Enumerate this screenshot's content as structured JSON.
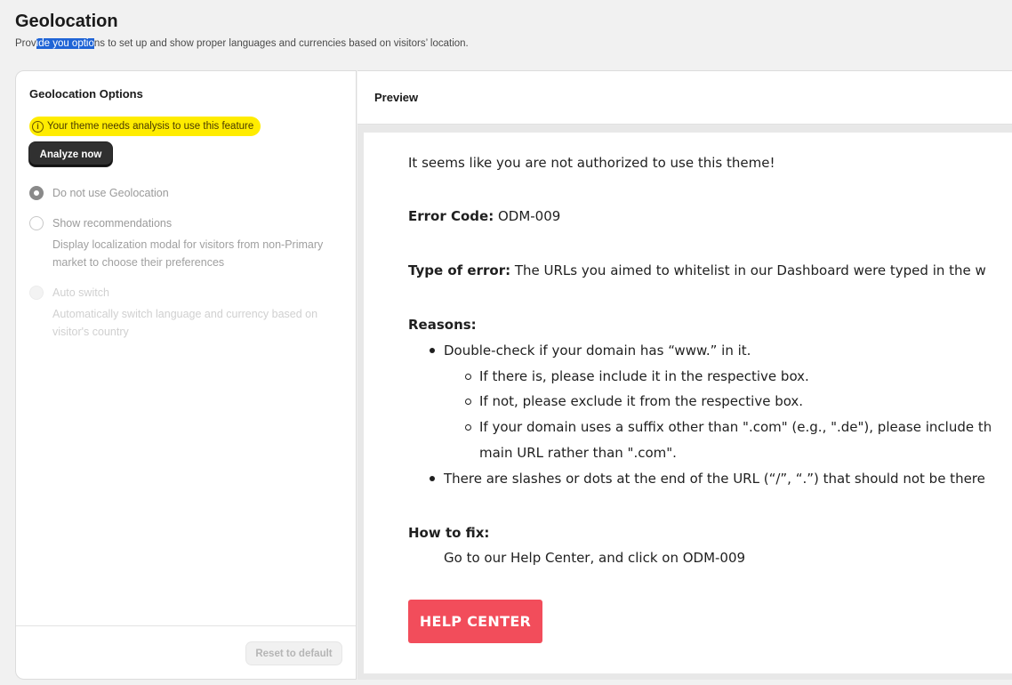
{
  "header": {
    "title": "Geolocation",
    "subtitle_pre": "Prov",
    "subtitle_selected": "ide you optio",
    "subtitle_post": "ns to set up and show proper languages and currencies based on visitors’ location."
  },
  "options": {
    "title": "Geolocation Options",
    "warning": "Your theme needs analysis to use this feature",
    "warning_icon": "info-icon",
    "analyze_label": "Analyze now",
    "radios": [
      {
        "label": "Do not use Geolocation",
        "checked": true
      },
      {
        "label": "Show recommendations",
        "desc": "Display localization modal for visitors from non-Primary market to choose their preferences"
      },
      {
        "label": "Auto switch",
        "desc": "Automatically switch language and currency based on visitor's country"
      }
    ],
    "reset_label": "Reset to default"
  },
  "preview": {
    "title": "Preview",
    "intro": "It seems like you are not authorized to use this theme!",
    "error_code_label": "Error Code:",
    "error_code_value": " ODM-009",
    "error_type_label": "Type of error:",
    "error_type_value": " The URLs you aimed to whitelist in our Dashboard were typed in the w",
    "reasons_label": "Reasons:",
    "reasons": [
      "Double-check if your domain has “www.” in it.",
      "If there is, please include it in the respective box.",
      "If not, please exclude it from the respective box.",
      "If your domain uses a suffix other than \".com\" (e.g., \".de\"), please include th",
      "main URL rather than \".com\".",
      "There are slashes or dots at the end of the URL (“/”, “.”) that should not be there"
    ],
    "fix_label": "How to fix:",
    "fix_text": "Go to our Help Center, and click on ODM-009",
    "help_button": "HELP CENTER",
    "help_button_color": "#f24d5b"
  }
}
